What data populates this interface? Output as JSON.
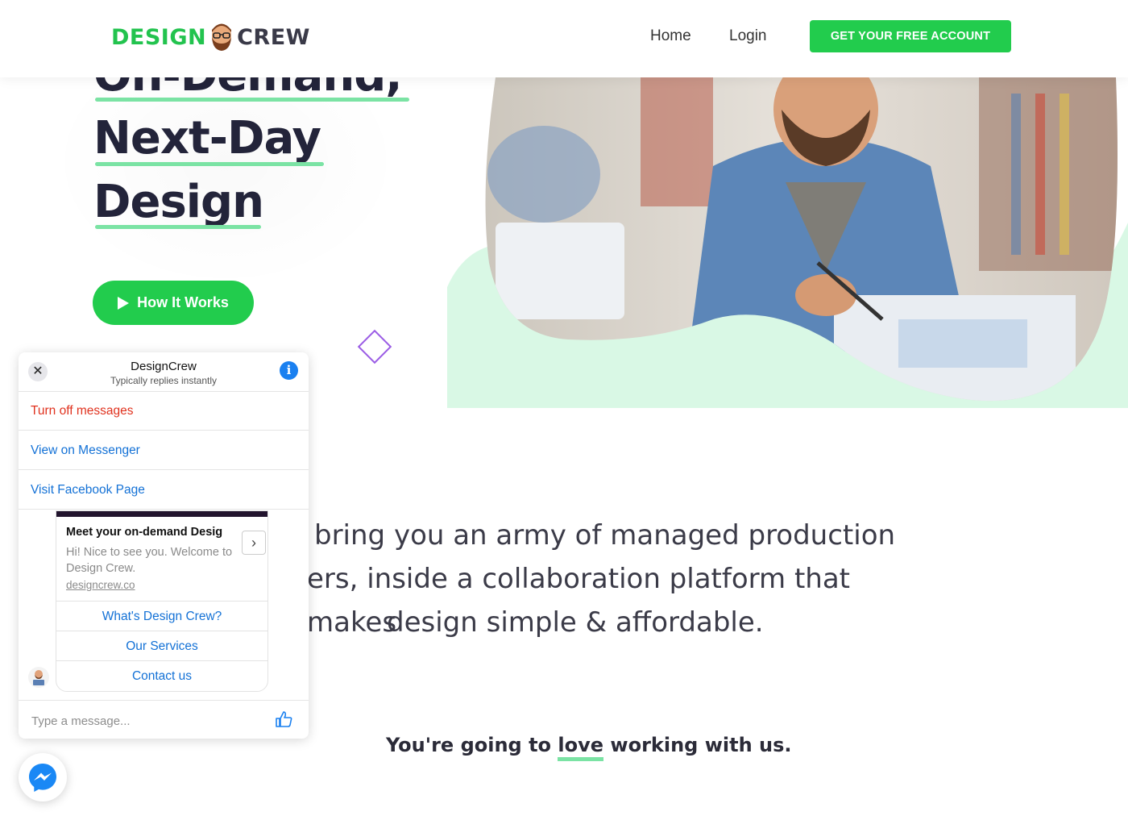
{
  "header": {
    "logo_left": "DESIGN",
    "logo_right": "CREW",
    "logo_icon": "bearded-face-icon",
    "nav": {
      "home": "Home",
      "login": "Login"
    },
    "cta_label": "GET YOUR FREE ACCOUNT"
  },
  "hero": {
    "headline_lines": [
      "On-Demand,",
      "Next-Day",
      "Design"
    ],
    "button_label": "How It Works",
    "button_icon": "play-icon"
  },
  "intro": {
    "line1": "bring you an army of managed production",
    "line2": "ers, inside a collaboration platform that makes",
    "line3": "design simple & affordable."
  },
  "tagline": {
    "before": "You're going to ",
    "highlight": "love",
    "after": " working with us."
  },
  "messenger": {
    "page_name": "DesignCrew",
    "status": "Typically replies instantly",
    "close_icon": "close-icon",
    "info_icon": "info-icon",
    "menu": [
      {
        "label": "Turn off messages",
        "color": "#e0321e"
      },
      {
        "label": "View on Messenger",
        "color": "#1371d6"
      },
      {
        "label": "Visit Facebook Page",
        "color": "#1371d6"
      }
    ],
    "card": {
      "title": "Meet your on-demand Desig",
      "description": "Hi! Nice to see you. Welcome to Design Crew.",
      "link": "designcrew.co",
      "buttons": [
        "What's Design Crew?",
        "Our Services",
        "Contact us"
      ]
    },
    "input_placeholder": "Type a message...",
    "send_icon": "thumbs-up-icon",
    "fab_icon": "messenger-icon"
  },
  "colors": {
    "brand_green": "#22cc4d",
    "underline_green": "#7be3a4",
    "diamond_purple": "#9b5de5",
    "ring_yellow": "#f2d04b",
    "messenger_blue": "#1371d6"
  }
}
